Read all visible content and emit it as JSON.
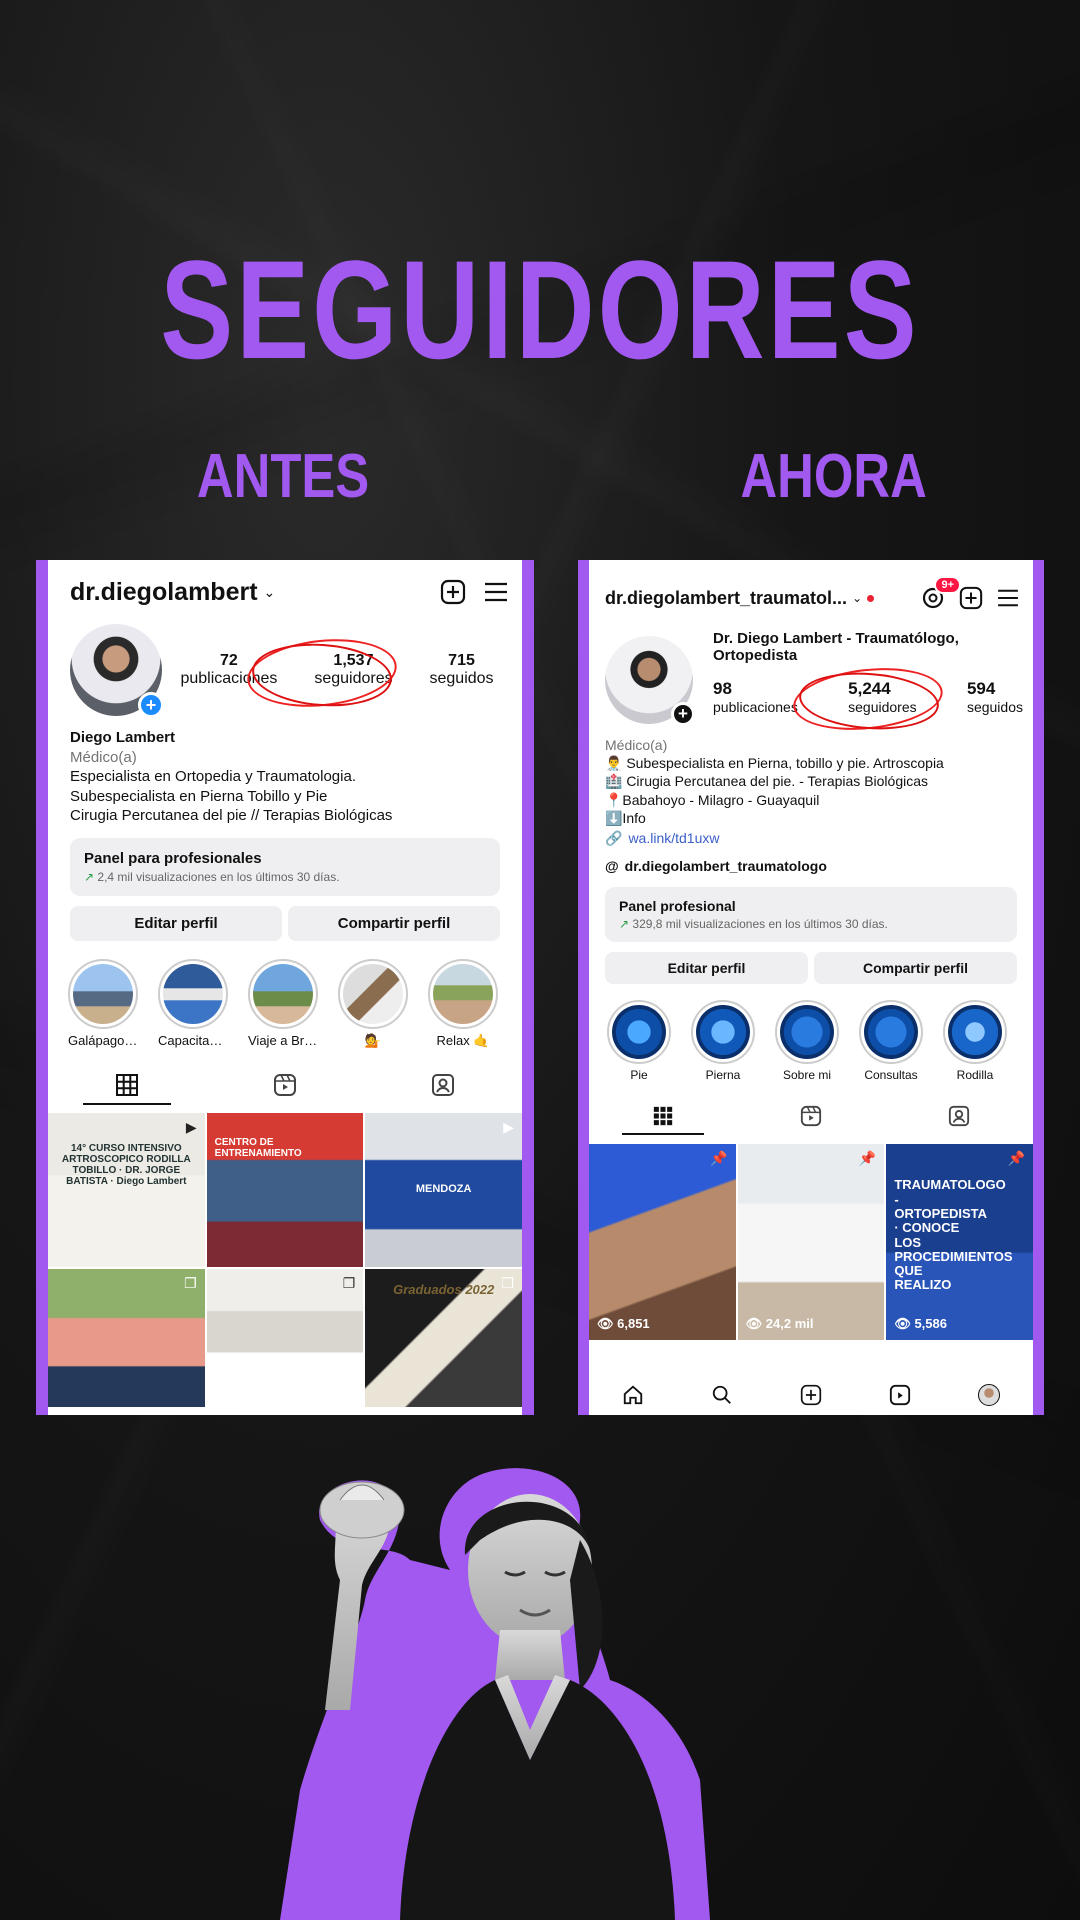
{
  "headline": "SEGUIDORES",
  "labels": {
    "before": "ANTES",
    "after": "AHORA"
  },
  "accent": "#a259f0",
  "before": {
    "handle": "dr.diegolambert",
    "stats": [
      {
        "value": "72",
        "label": "publicaciones"
      },
      {
        "value": "1,537",
        "label": "seguidores"
      },
      {
        "value": "715",
        "label": "seguidos"
      }
    ],
    "name": "Diego Lambert",
    "category": "Médico(a)",
    "bio": [
      "Especialista en Ortopedia y Traumatologia.",
      "Subespecialista en Pierna Tobillo y Pie",
      "Cirugia Percutanea del pie // Terapias Biológicas"
    ],
    "panel": {
      "title": "Panel para profesionales",
      "subtitle": "2,4 mil visualizaciones en los últimos 30 días."
    },
    "buttons": {
      "edit": "Editar perfil",
      "share": "Compartir perfil"
    },
    "highlights": [
      "Galápagos...",
      "Capacitació...",
      "Viaje a Brasil",
      "💁",
      "Relax 🤙"
    ],
    "posts": [
      {
        "text": "14° CURSO INTENSIVO ARTROSCOPICO RODILLA TOBILLO · DR. JORGE BATISTA · Diego Lambert"
      },
      {
        "text": "CENTRO DE ENTRENAMIENTO"
      },
      {
        "text": "MENDOZA"
      },
      {
        "text": ""
      },
      {
        "text": ""
      },
      {
        "text": "Graduados 2022"
      }
    ]
  },
  "after": {
    "handle": "dr.diegolambert_traumatol...",
    "notification_badge": "9+",
    "display_name": "Dr. Diego Lambert - Traumatólogo, Ortopedista",
    "stats": [
      {
        "value": "98",
        "label": "publicaciones"
      },
      {
        "value": "5,244",
        "label": "seguidores"
      },
      {
        "value": "594",
        "label": "seguidos"
      }
    ],
    "category": "Médico(a)",
    "bio": [
      "👨‍⚕️ Subespecialista en Pierna, tobillo y pie. Artroscopia",
      "🏥 Cirugia Percutanea del pie. - Terapias Biológicas",
      "📍Babahoyo - Milagro - Guayaquil",
      "⬇️Info"
    ],
    "link": "wa.link/td1uxw",
    "threads": "dr.diegolambert_traumatologo",
    "panel": {
      "title": "Panel profesional",
      "subtitle": "329,8 mil visualizaciones en los últimos 30 días."
    },
    "buttons": {
      "edit": "Editar perfil",
      "share": "Compartir perfil"
    },
    "highlights": [
      "Pie",
      "Pierna",
      "Sobre  mi",
      "Consultas",
      "Rodilla"
    ],
    "posts": [
      {
        "views": "6,851",
        "text": ""
      },
      {
        "views": "24,2 mil",
        "text": ""
      },
      {
        "views": "5,586",
        "text": "TRAUMATOLOGO - ORTOPEDISTA · CONOCE LOS PROCEDIMIENTOS QUE REALIZO"
      }
    ]
  }
}
